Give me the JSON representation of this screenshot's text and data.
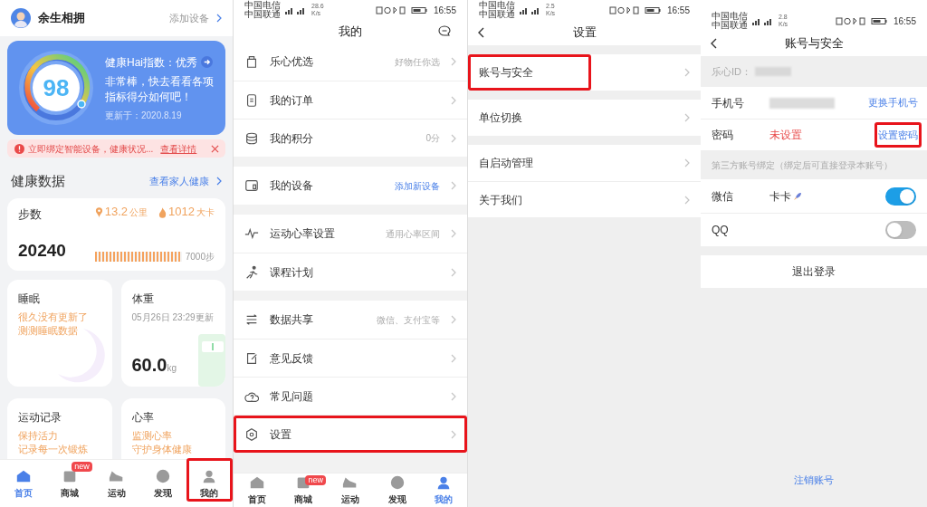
{
  "home": {
    "user_name": "余生相拥",
    "add_device": "添加设备",
    "health_card": {
      "title": "健康Hai指数：优秀",
      "message": "非常棒，快去看看各项指标得分如何吧！",
      "updated": "更新于：2020.8.19",
      "score": "98"
    },
    "alert": {
      "text": "立即绑定智能设备，健康状况...",
      "link": "查看详情"
    },
    "section_title": "健康数据",
    "family_link": "查看家人健康",
    "steps": {
      "label": "步数",
      "value": "20240",
      "distance": "13.2",
      "distance_unit": "公里",
      "calories": "1012",
      "calories_unit": "大卡",
      "goal": "7000步",
      "level": 1
    },
    "cards": [
      {
        "kind": "sleep",
        "title": "睡眠",
        "lines": [
          "很久没有更新了",
          "测测睡眠数据"
        ]
      },
      {
        "kind": "weight",
        "title": "体重",
        "subtitle": "05月26日 23:29更新",
        "value": "60.0",
        "unit": "kg"
      },
      {
        "kind": "exercise",
        "title": "运动记录",
        "lines": [
          "保持活力",
          "记录每一次锻炼"
        ]
      },
      {
        "kind": "heart",
        "title": "心率",
        "lines": [
          "监测心率",
          "守护身体健康"
        ]
      }
    ],
    "tabs": [
      {
        "label": "首页",
        "selected": true,
        "highlighted": false
      },
      {
        "label": "商城",
        "badge": "new",
        "selected": false,
        "highlighted": false
      },
      {
        "label": "运动",
        "selected": false,
        "highlighted": false
      },
      {
        "label": "发现",
        "selected": false,
        "highlighted": false
      },
      {
        "label": "我的",
        "selected": false,
        "highlighted": true
      }
    ]
  },
  "mine": {
    "status_bar": {
      "carriers": [
        "中国电信",
        "中国联通"
      ],
      "speed": "28.6",
      "speed_unit": "K/s",
      "time": "16:55"
    },
    "title": "我的",
    "groups": [
      [
        {
          "label": "乐心优选",
          "value": "好物任你选",
          "value_link": false,
          "highlighted": false
        },
        {
          "label": "我的订单",
          "highlighted": false
        },
        {
          "label": "我的积分",
          "value": "0分",
          "value_link": false,
          "highlighted": false
        }
      ],
      [
        {
          "label": "我的设备",
          "value": "添加新设备",
          "value_link": true,
          "highlighted": false
        }
      ],
      [
        {
          "label": "运动心率设置",
          "value": "通用心率区间",
          "value_link": false,
          "highlighted": false
        },
        {
          "label": "课程计划",
          "highlighted": false
        }
      ],
      [
        {
          "label": "数据共享",
          "value": "微信、支付宝等",
          "value_link": false,
          "highlighted": false
        },
        {
          "label": "意见反馈",
          "highlighted": false
        },
        {
          "label": "常见问题",
          "highlighted": false
        },
        {
          "label": "设置",
          "highlighted": true
        }
      ]
    ],
    "tabs": [
      {
        "label": "首页",
        "selected": false
      },
      {
        "label": "商城",
        "badge": "new",
        "selected": false
      },
      {
        "label": "运动",
        "selected": false
      },
      {
        "label": "发现",
        "selected": false
      },
      {
        "label": "我的",
        "selected": true
      }
    ]
  },
  "settings": {
    "status_bar": {
      "carriers": [
        "中国电信",
        "中国联通"
      ],
      "speed": "2.5",
      "speed_unit": "K/s",
      "time": "16:55"
    },
    "title": "设置",
    "groups": [
      [
        {
          "label": "账号与安全",
          "highlighted": true
        }
      ],
      [
        {
          "label": "单位切换",
          "highlighted": false
        }
      ],
      [
        {
          "label": "自启动管理",
          "highlighted": false
        },
        {
          "label": "关于我们",
          "highlighted": false
        }
      ]
    ]
  },
  "account": {
    "status_bar": {
      "carriers": [
        "中国电信",
        "中国联通"
      ],
      "speed": "2.8",
      "speed_unit": "K/s",
      "time": "16:55"
    },
    "title": "账号与安全",
    "id_label": "乐心ID：",
    "rows": [
      {
        "label": "手机号",
        "action": "更换手机号",
        "highlighted": false
      },
      {
        "label": "密码",
        "value": "未设置",
        "action": "设置密码",
        "highlighted": true
      }
    ],
    "bind_title": "第三方账号绑定（绑定后可直接登录本账号）",
    "bindings": [
      {
        "label": "微信",
        "value": "卡卡",
        "on": true
      },
      {
        "label": "QQ",
        "on": false
      }
    ],
    "logout": "退出登录",
    "delete_account": "注销账号"
  }
}
